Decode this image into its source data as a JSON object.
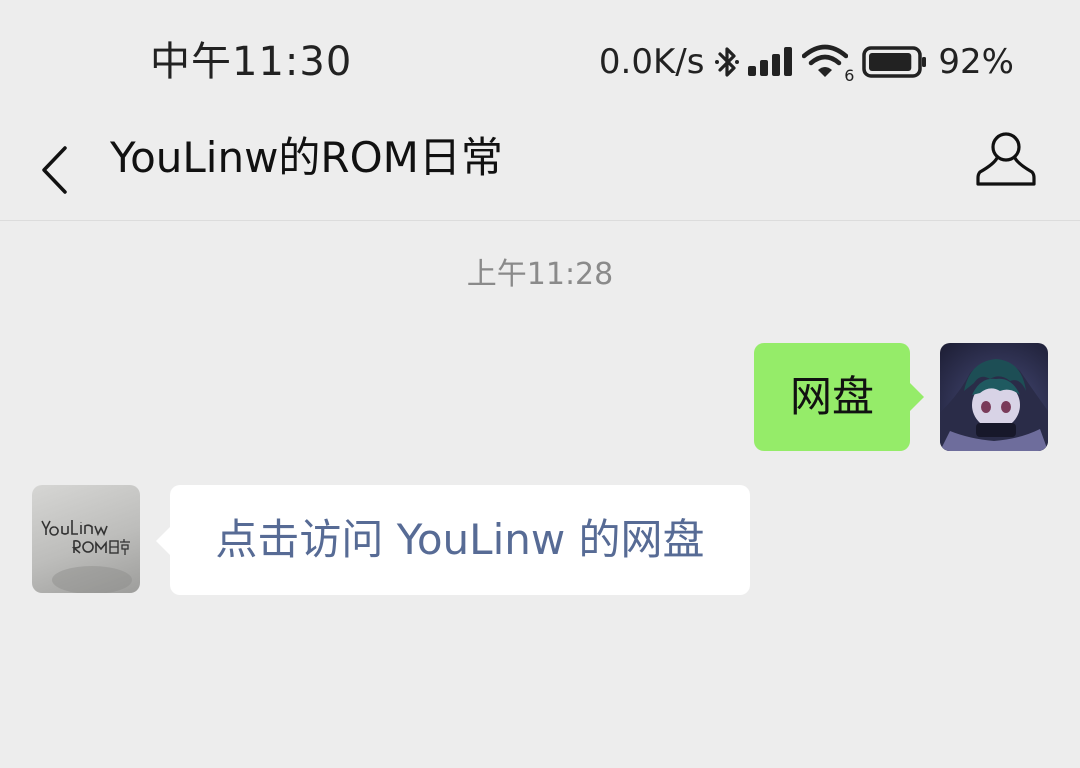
{
  "status_bar": {
    "time": "中午11:30",
    "net_speed": "0.0K/s",
    "wifi_badge": "6",
    "battery_percent": "92%",
    "battery_level": 0.92,
    "icons": [
      "bluetooth-icon",
      "signal-icon",
      "wifi-icon",
      "battery-icon"
    ]
  },
  "nav": {
    "title": "YouLinw的ROM日常",
    "back_icon": "chevron-left-icon",
    "profile_icon": "person-icon"
  },
  "chat": {
    "timestamp": "上午11:28",
    "messages": [
      {
        "direction": "out",
        "text": "网盘",
        "avatar": "user-avatar"
      },
      {
        "direction": "in",
        "text": "点击访问 YouLinw 的网盘",
        "avatar": "youlinw-rom-logo",
        "is_link": true
      }
    ]
  },
  "colors": {
    "background": "#ededed",
    "outgoing_bubble": "#95ec69",
    "incoming_bubble": "#ffffff",
    "link_text": "#576b95",
    "timestamp_text": "#8a8a8a"
  }
}
